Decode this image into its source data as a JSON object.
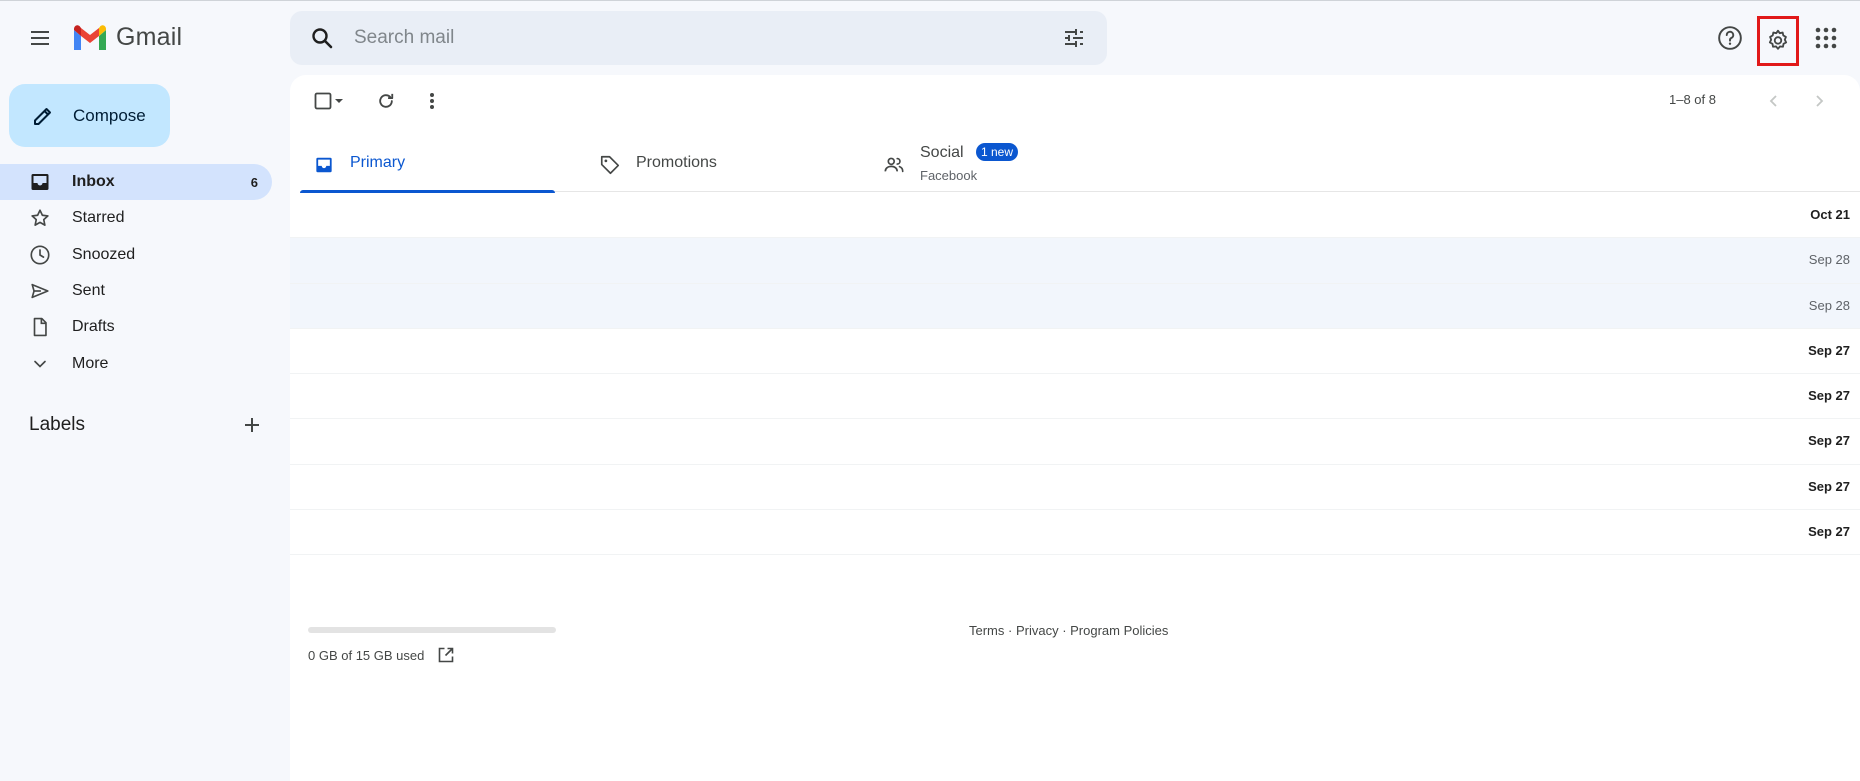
{
  "header": {
    "app_name": "Gmail",
    "search_placeholder": "Search mail"
  },
  "sidebar": {
    "compose_label": "Compose",
    "items": [
      {
        "label": "Inbox",
        "count": "6",
        "icon": "inbox-icon"
      },
      {
        "label": "Starred",
        "count": "",
        "icon": "star-icon"
      },
      {
        "label": "Snoozed",
        "count": "",
        "icon": "clock-icon"
      },
      {
        "label": "Sent",
        "count": "",
        "icon": "send-icon"
      },
      {
        "label": "Drafts",
        "count": "",
        "icon": "draft-icon"
      },
      {
        "label": "More",
        "count": "",
        "icon": "chevron-down-icon"
      }
    ],
    "labels_heading": "Labels"
  },
  "toolbar": {
    "pager_text": "1–8 of 8"
  },
  "tabs": [
    {
      "label": "Primary",
      "icon": "inbox-icon",
      "active": true
    },
    {
      "label": "Promotions",
      "icon": "tag-icon",
      "active": false
    },
    {
      "label": "Social",
      "icon": "people-icon",
      "badge": "1 new",
      "sub": "Facebook",
      "active": false
    }
  ],
  "emails": [
    {
      "date": "Oct 21",
      "read": false
    },
    {
      "date": "Sep 28",
      "read": true
    },
    {
      "date": "Sep 28",
      "read": true
    },
    {
      "date": "Sep 27",
      "read": false
    },
    {
      "date": "Sep 27",
      "read": false
    },
    {
      "date": "Sep 27",
      "read": false
    },
    {
      "date": "Sep 27",
      "read": false
    },
    {
      "date": "Sep 27",
      "read": false
    }
  ],
  "footer": {
    "storage_text": "0 GB of 15 GB used",
    "storage_used_fraction": 0,
    "terms": "Terms",
    "privacy": "Privacy",
    "policies": "Program Policies",
    "separator": " · "
  },
  "colors": {
    "accent": "#0b57d0",
    "compose_bg": "#c2e7ff",
    "active_nav_bg": "#d3e3fd",
    "highlight_box": "#e11919"
  }
}
